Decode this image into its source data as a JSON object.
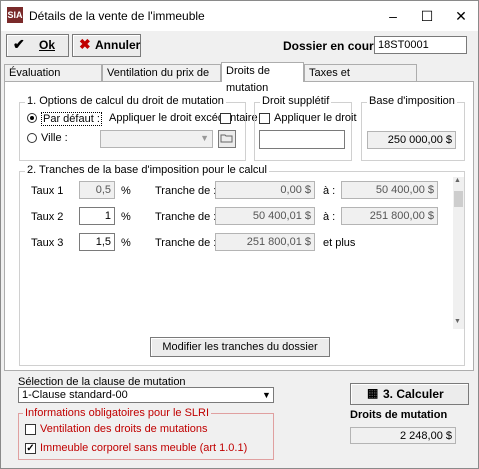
{
  "window": {
    "title": "Détails de la vente de l'immeuble",
    "app_icon": "SIA"
  },
  "toolbar": {
    "ok_label": "Ok",
    "cancel_label": "Annuler",
    "dossier_label": "Dossier en cours :",
    "dossier_value": "18ST0001"
  },
  "tabs": [
    {
      "label": "Évaluation municipale"
    },
    {
      "label": "Ventilation du prix de vente"
    },
    {
      "label": "Droits de mutation"
    },
    {
      "label": "Taxes et remboursements"
    }
  ],
  "options": {
    "title": "1. Options de calcul du droit de mutation",
    "par_defaut": "Par défaut :",
    "appliquer_excedentaire": "Appliquer le droit excédentaire",
    "ville": "Ville :"
  },
  "supp": {
    "title": "Droit supplétif",
    "apply": "Appliquer le droit"
  },
  "base": {
    "title": "Base d'imposition",
    "value": "250 000,00 $"
  },
  "tranches": {
    "title": "2. Tranches de la base d'imposition pour le calcul",
    "rows": [
      {
        "label": "Taux 1",
        "rate": "0,5",
        "pct": "%",
        "tranche_label": "Tranche de :",
        "from": "0,00 $",
        "a": "à :",
        "to": "50 400,00 $"
      },
      {
        "label": "Taux 2",
        "rate": "1",
        "pct": "%",
        "tranche_label": "Tranche de :",
        "from": "50 400,01 $",
        "a": "à :",
        "to": "251 800,00 $"
      },
      {
        "label": "Taux 3",
        "rate": "1,5",
        "pct": "%",
        "tranche_label": "Tranche de :",
        "from": "251 800,01 $",
        "a": "et plus",
        "to": ""
      }
    ],
    "modify_button": "Modifier les tranches du dossier"
  },
  "clause": {
    "label": "Sélection de la clause de mutation",
    "value": "1-Clause standard-00"
  },
  "slri": {
    "title": "Informations obligatoires pour le SLRI",
    "ventilation": "Ventilation des droits de mutations",
    "immeuble": "Immeuble corporel sans meuble (art 1.0.1)"
  },
  "calc": {
    "button": "3. Calculer",
    "droits_label": "Droits de mutation",
    "droits_value": "2 248,00 $"
  }
}
